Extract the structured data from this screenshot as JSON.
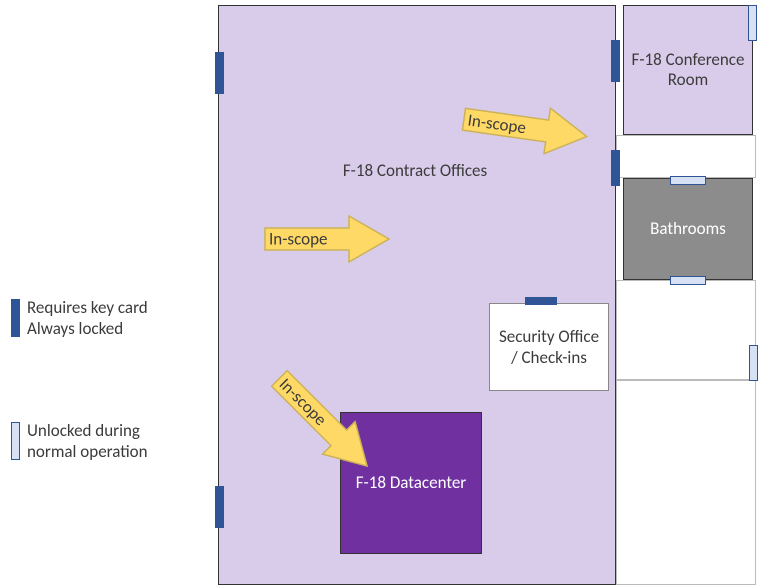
{
  "colors": {
    "lavender": "#d9ccea",
    "purple": "#7030a0",
    "gray": "#8c8c8c",
    "doorLocked": "#2f5597",
    "doorUnlockedFill": "#d6e2f3",
    "roomBorder": "#333333",
    "arrowFill": "#ffd966",
    "arrowStroke": "#cbb258"
  },
  "rooms": {
    "contractOffices": {
      "label": "F-18 Contract Offices"
    },
    "conferenceRoom": {
      "label": "F-18\nConference\nRoom"
    },
    "bathrooms": {
      "label": "Bathrooms"
    },
    "securityOffice": {
      "label": "Security\nOffice /\nCheck-ins"
    },
    "datacenter": {
      "label": "F-18\nDatacenter"
    }
  },
  "arrows": {
    "a1": {
      "label": "In-scope"
    },
    "a2": {
      "label": "In-scope"
    },
    "a3": {
      "label": "In-scope"
    }
  },
  "legend": {
    "locked": "Requires key card\nAlways locked",
    "unlocked": "Unlocked during\nnormal operation"
  }
}
